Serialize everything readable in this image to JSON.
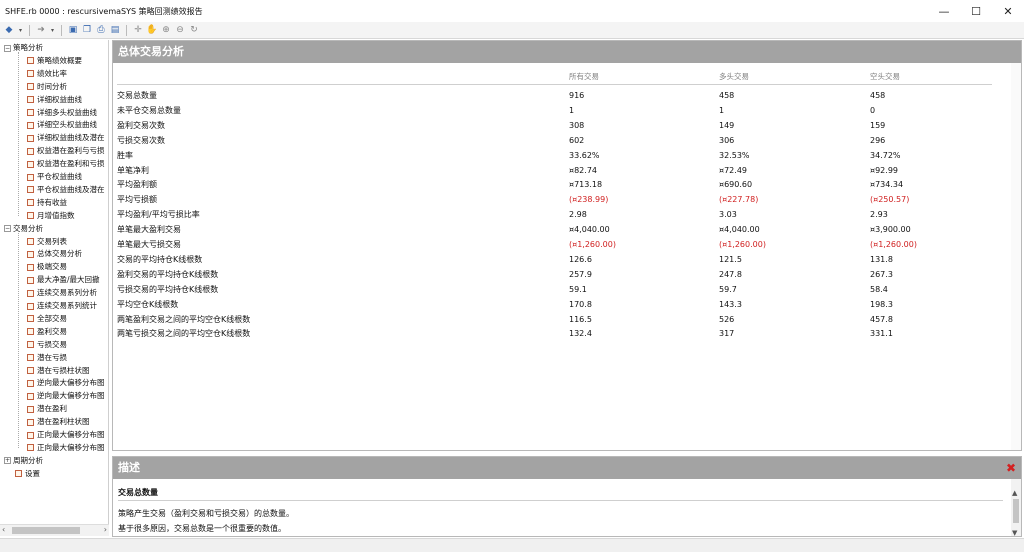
{
  "window": {
    "title": "SHFE.rb 0000 : rescursivemaSYS 策略回测绩效报告",
    "minimize": "—",
    "maximize": "☐",
    "close": "✕"
  },
  "toolbar": {
    "icons": [
      "back-icon",
      "forward-icon",
      "save-icon",
      "copy-icon",
      "print-icon",
      "table-icon",
      "crosshair-icon",
      "hand-icon",
      "zoom-in-icon",
      "zoom-out-icon",
      "refresh-icon"
    ]
  },
  "tree": {
    "groups": [
      {
        "label": "策略分析",
        "expander": "−",
        "items": [
          "策略绩效概要",
          "绩效比率",
          "时间分析",
          "详细权益曲线",
          "详细多头权益曲线",
          "详细空头权益曲线",
          "详细权益曲线及潜在",
          "权益潜在盈利与亏损",
          "权益潜在盈利和亏损",
          "平仓权益曲线",
          "平仓权益曲线及潜在",
          "持有收益",
          "月增值指数"
        ]
      },
      {
        "label": "交易分析",
        "expander": "−",
        "items": [
          "交易列表",
          "总体交易分析",
          "极端交易",
          "最大净盈/最大回撤",
          "连续交易系列分析",
          "连续交易系列统计",
          "全部交易",
          "盈利交易",
          "亏损交易",
          "潜在亏损",
          "潜在亏损柱状图",
          "逆向最大偏移分布图",
          "逆向最大偏移分布图",
          "潜在盈利",
          "潜在盈利柱状图",
          "正向最大偏移分布图",
          "正向最大偏移分布图"
        ]
      },
      {
        "label": "周期分析",
        "expander": "+",
        "items": []
      }
    ],
    "settings_label": "设置",
    "selected": "总体交易分析"
  },
  "main": {
    "header": "总体交易分析",
    "columns": [
      "所有交易",
      "多头交易",
      "空头交易"
    ],
    "rows": [
      {
        "label": "交易总数量",
        "all": "916",
        "long": "458",
        "short": "458"
      },
      {
        "label": "未平仓交易总数量",
        "all": "1",
        "long": "1",
        "short": "0"
      },
      {
        "label": "盈利交易次数",
        "all": "308",
        "long": "149",
        "short": "159"
      },
      {
        "label": "亏损交易次数",
        "all": "602",
        "long": "306",
        "short": "296"
      },
      {
        "label": "胜率",
        "all": "33.62%",
        "long": "32.53%",
        "short": "34.72%"
      },
      {
        "label": "单笔净利",
        "all": "¤82.74",
        "long": "¤72.49",
        "short": "¤92.99"
      },
      {
        "label": "平均盈利额",
        "all": "¤713.18",
        "long": "¤690.60",
        "short": "¤734.34"
      },
      {
        "label": "平均亏损额",
        "all": "(¤238.99)",
        "long": "(¤227.78)",
        "short": "(¤250.57)",
        "negative": true
      },
      {
        "label": "平均盈利/平均亏损比率",
        "all": "2.98",
        "long": "3.03",
        "short": "2.93"
      },
      {
        "label": "单笔最大盈利交易",
        "all": "¤4,040.00",
        "long": "¤4,040.00",
        "short": "¤3,900.00"
      },
      {
        "label": "单笔最大亏损交易",
        "all": "(¤1,260.00)",
        "long": "(¤1,260.00)",
        "short": "(¤1,260.00)",
        "negative": true
      },
      {
        "label": "交易的平均持仓K线根数",
        "all": "126.6",
        "long": "121.5",
        "short": "131.8"
      },
      {
        "label": "盈利交易的平均持仓K线根数",
        "all": "257.9",
        "long": "247.8",
        "short": "267.3"
      },
      {
        "label": "亏损交易的平均持仓K线根数",
        "all": "59.1",
        "long": "59.7",
        "short": "58.4"
      },
      {
        "label": "平均空仓K线根数",
        "all": "170.8",
        "long": "143.3",
        "short": "198.3"
      },
      {
        "label": "两笔盈利交易之间的平均空仓K线根数",
        "all": "116.5",
        "long": "526",
        "short": "457.8"
      },
      {
        "label": "两笔亏损交易之间的平均空仓K线根数",
        "all": "132.4",
        "long": "317",
        "short": "331.1"
      }
    ],
    "negative_color": "#d02020"
  },
  "description": {
    "header": "描述",
    "title": "交易总数量",
    "lines": [
      "策略产生交易（盈利交易和亏损交易）的总数量。",
      "基于很多原因，交易总数是一个很重要的数值。"
    ]
  }
}
